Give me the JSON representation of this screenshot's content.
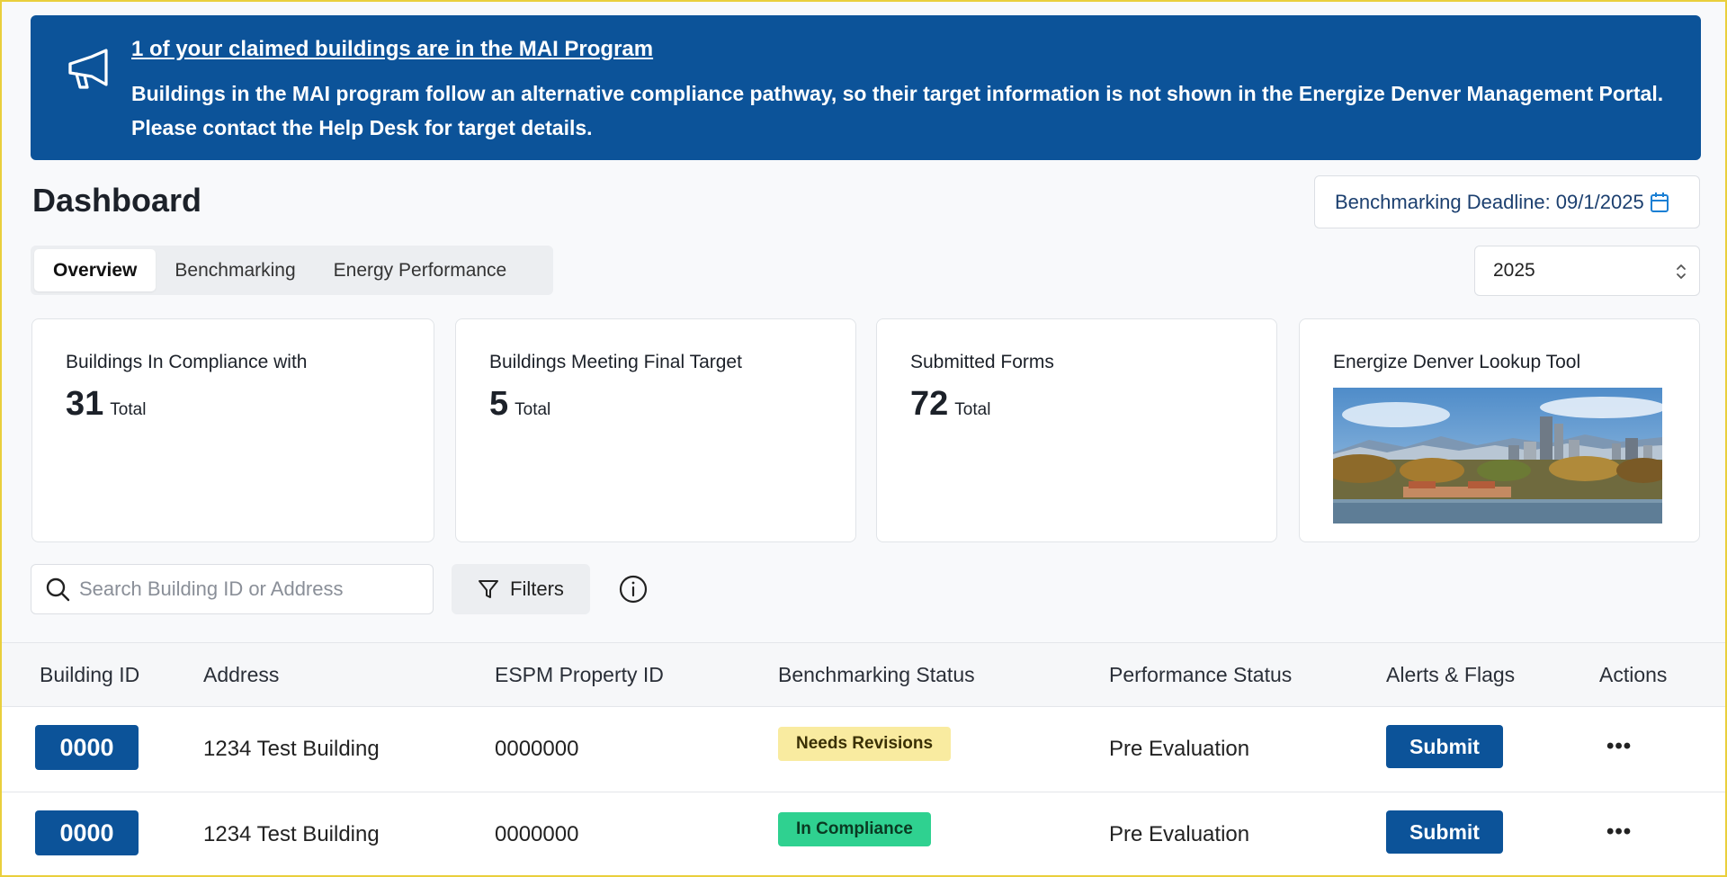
{
  "banner": {
    "title": "1 of your claimed buildings are in the MAI Program",
    "body": "Buildings in the MAI program follow an alternative compliance pathway, so their target information is not shown in the Energize Denver Management Portal. Please contact the Help Desk for target details.",
    "icon": "megaphone-icon",
    "color": "#0c5399"
  },
  "page": {
    "title": "Dashboard",
    "deadline": "Benchmarking Deadline: 09/1/2025"
  },
  "tabs": [
    {
      "label": "Overview",
      "active": true
    },
    {
      "label": "Benchmarking",
      "active": false
    },
    {
      "label": "Energy Performance",
      "active": false
    }
  ],
  "year_select": {
    "value": "2025"
  },
  "cards": [
    {
      "label": "Buildings In Compliance with",
      "value": "31",
      "unit": "Total"
    },
    {
      "label": "Buildings Meeting Final Target",
      "value": "5",
      "unit": "Total"
    },
    {
      "label": "Submitted Forms",
      "value": "72",
      "unit": "Total"
    },
    {
      "label": "Energize Denver Lookup Tool"
    }
  ],
  "search": {
    "placeholder": "Search Building ID or Address"
  },
  "filters": {
    "label": "Filters"
  },
  "table": {
    "headers": [
      "Building ID",
      "Address",
      "ESPM Property ID",
      "Benchmarking Status",
      "Performance Status",
      "Alerts & Flags",
      "Actions"
    ],
    "rows": [
      {
        "id": "0000",
        "address": "1234 Test Building",
        "espm": "0000000",
        "benchmarking_status": "Needs Revisions",
        "status_color": "#f9eba0",
        "performance_status": "Pre Evaluation",
        "alert_action": "Submit",
        "more": "•••"
      },
      {
        "id": "0000",
        "address": "1234 Test Building",
        "espm": "0000000",
        "benchmarking_status": "In Compliance",
        "status_color": "#2fd190",
        "performance_status": "Pre Evaluation",
        "alert_action": "Submit",
        "more": "•••"
      }
    ]
  }
}
